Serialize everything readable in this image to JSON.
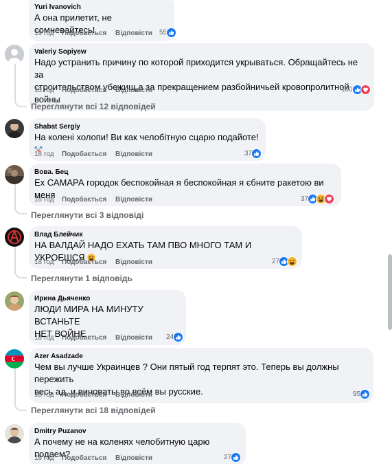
{
  "comments": [
    {
      "author": "Yuri Ivanovich",
      "text": "А она прилетит, не сомневайтесь!",
      "time": "19 год",
      "like_label": "Подобається",
      "reply_label": "Відповісти",
      "reaction_count": "55",
      "reactions": [
        "like"
      ]
    },
    {
      "author": "Valeriy Sopiyew",
      "text_lines": [
        "Надо устранить причину по которой приходится укрываться. Обращайтесь не за",
        "строительством убежищ,а за прекращением разбойничьей кровопролитной войны"
      ],
      "time": "18 год",
      "like_label": "Подобається",
      "reply_label": "Відповісти",
      "reaction_count": "100",
      "reactions": [
        "like",
        "love"
      ],
      "view_replies": "Переглянути всі 12 відповідей"
    },
    {
      "author": "Shabat Sergiy",
      "text": "На колені холопи! Ви как челобітную сцарю подайоте!",
      "time": "18 год",
      "like_label": "Подобається",
      "reply_label": "Відповісти",
      "reaction_count": "37",
      "reactions": [
        "like"
      ]
    },
    {
      "author": "Вова. Бец",
      "text": "Ех САМАРА городок беспокойная я беспокойная я єбните ракетою ви меня",
      "time": "18 год",
      "like_label": "Подобається",
      "reply_label": "Відповісти",
      "reaction_count": "37",
      "reactions": [
        "like",
        "haha",
        "love"
      ],
      "view_replies": "Переглянути всі 3 відповіді"
    },
    {
      "author": "Влад Блейчик",
      "text": "НА ВАЛДАЙ НАДО ЕХАТЬ ТАМ ПВО МНОГО ТАМ И УКРОЕШСЯ",
      "time": "18 год",
      "like_label": "Подобається",
      "reply_label": "Відповісти",
      "reaction_count": "27",
      "reactions": [
        "like",
        "haha"
      ],
      "view_replies": "Переглянути 1 відповідь"
    },
    {
      "author": "Ирина Дьяченко",
      "text_lines": [
        "ЛЮДИ МИРА НА МИНУТУ ВСТАНЬТЕ",
        "НЕТ ВОЙНЕ"
      ],
      "time": "18 год",
      "like_label": "Подобається",
      "reply_label": "Відповісти",
      "reaction_count": "24",
      "reactions": [
        "like"
      ]
    },
    {
      "author": "Azer Asadzade",
      "text_lines": [
        "Чем вы лучше Украинцев ? Они пятый год терпят это. Теперь вы должны пережить",
        "весь ад, и виноваты во всём вы русские."
      ],
      "time": "18 год",
      "like_label": "Подобається",
      "reply_label": "Відповісти",
      "reaction_count": "95",
      "reactions": [
        "like"
      ],
      "view_replies": "Переглянути всі 18 відповідей"
    },
    {
      "author": "Dmitry Puzanov",
      "text": "А почему не на коленях челобитную царю подаем?",
      "time": "18 год",
      "like_label": "Подобається",
      "reply_label": "Відповісти",
      "reaction_count": "27",
      "reactions": [
        "like"
      ]
    }
  ],
  "colors": {
    "bubble": "#f0f2f5",
    "meta_text": "#65676b",
    "like_blue": "#1877f2",
    "love_red": "#f33e58",
    "haha_yellow": "#f7b125"
  }
}
